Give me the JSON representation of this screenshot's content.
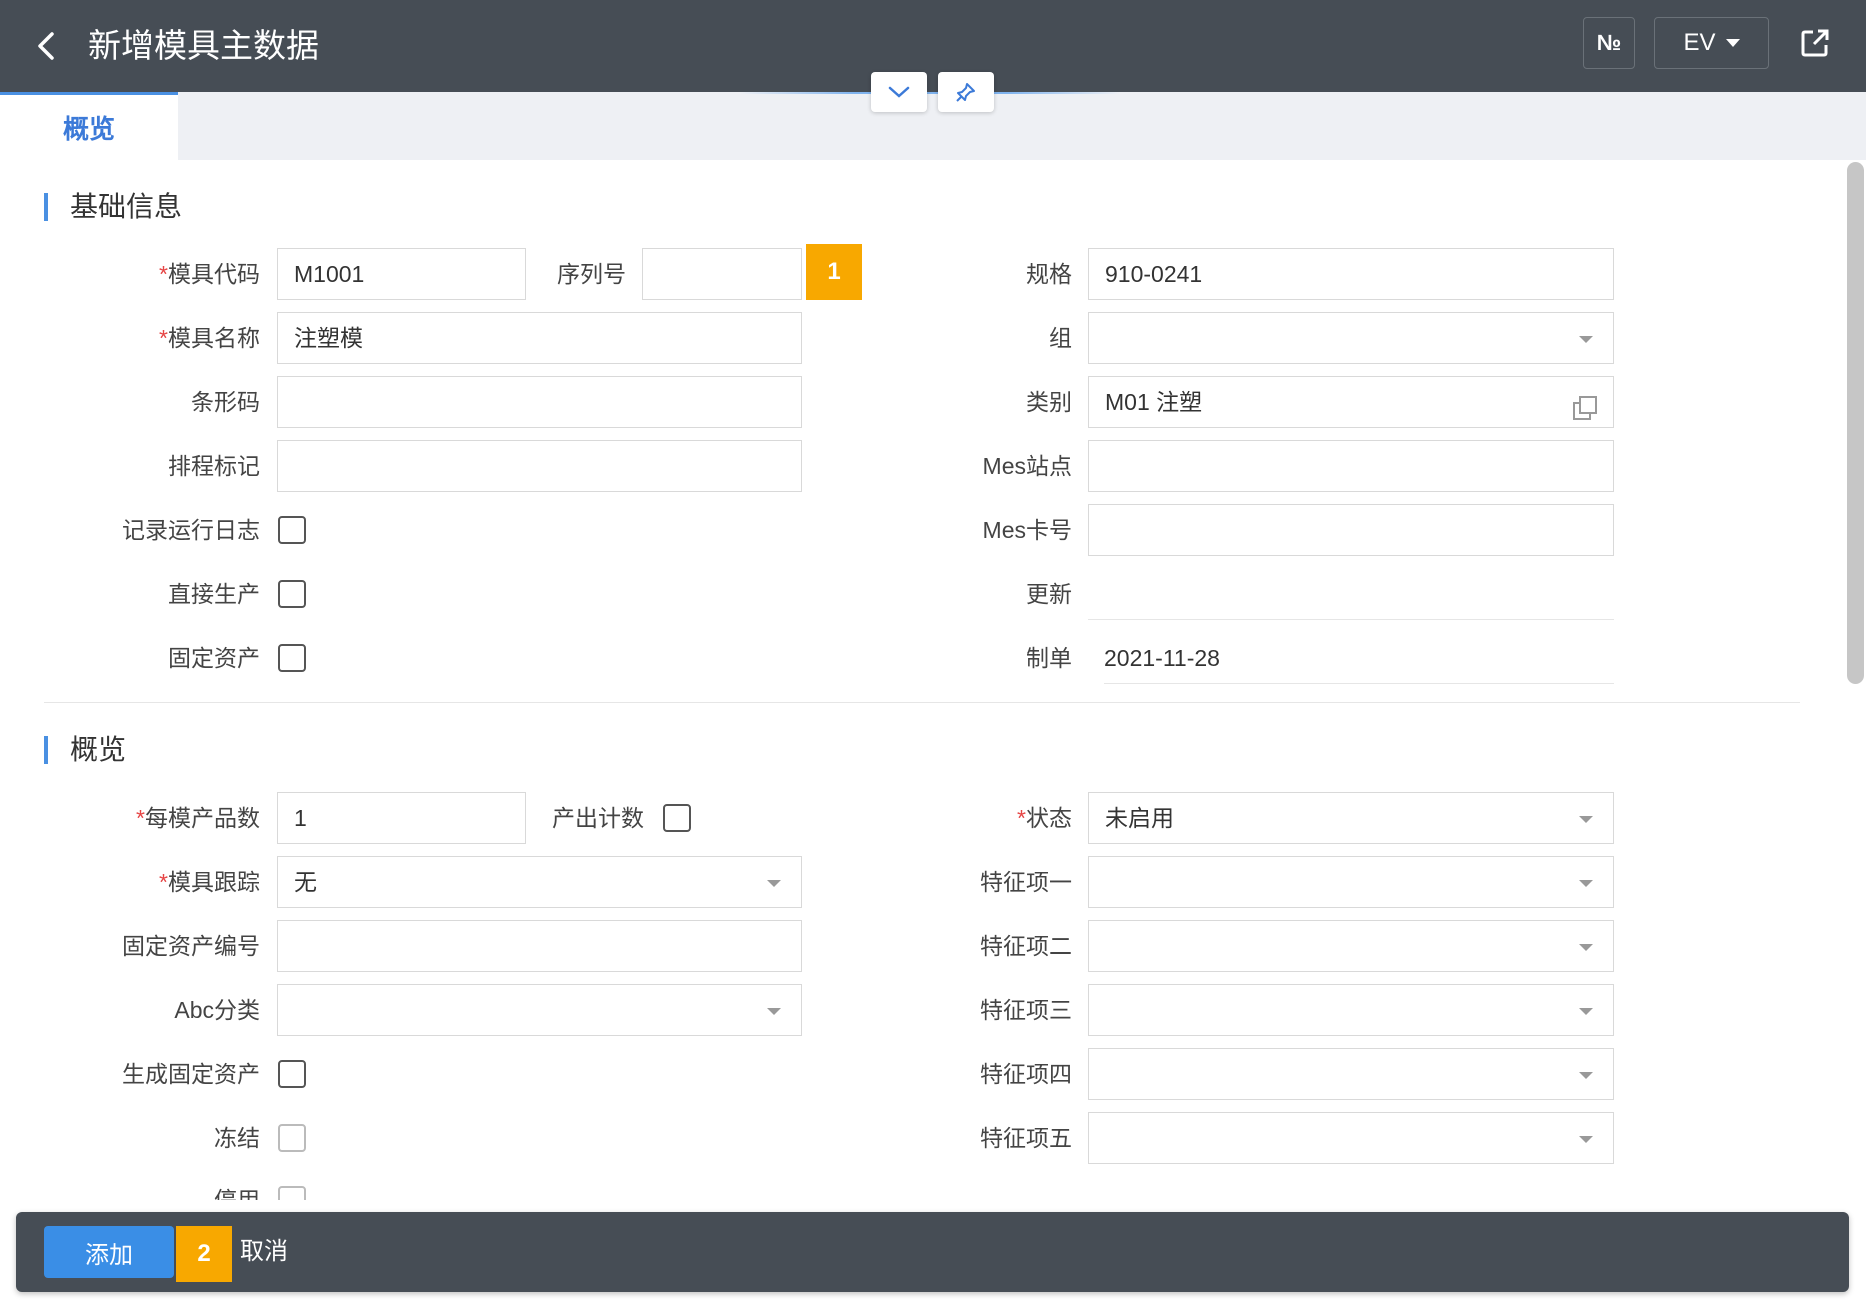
{
  "header": {
    "title": "新增模具主数据",
    "no_button": "№",
    "ev_button": "EV"
  },
  "tabs": [
    {
      "label": "概览"
    }
  ],
  "sections": {
    "basic": "基础信息",
    "overview": "概览"
  },
  "basic": {
    "mold_code": {
      "label": "模具代码",
      "value": "M1001",
      "required": "*"
    },
    "serial_no": {
      "label": "序列号",
      "value": ""
    },
    "spec": {
      "label": "规格",
      "value": "910-0241"
    },
    "mold_name": {
      "label": "模具名称",
      "value": "注塑模",
      "required": "*"
    },
    "group": {
      "label": "组",
      "value": ""
    },
    "barcode": {
      "label": "条形码",
      "value": ""
    },
    "category": {
      "label": "类别",
      "value": "M01 注塑"
    },
    "schedule_mark": {
      "label": "排程标记",
      "value": ""
    },
    "mes_station": {
      "label": "Mes站点",
      "value": ""
    },
    "log_run": {
      "label": "记录运行日志",
      "checked": false
    },
    "mes_card": {
      "label": "Mes卡号",
      "value": ""
    },
    "direct_prod": {
      "label": "直接生产",
      "checked": false
    },
    "update": {
      "label": "更新",
      "value": ""
    },
    "fixed_asset": {
      "label": "固定资产",
      "checked": false
    },
    "creator": {
      "label": "制单",
      "value": "2021-11-28"
    }
  },
  "overview": {
    "per_mold": {
      "label": "每模产品数",
      "value": "1",
      "required": "*"
    },
    "output_count": {
      "label": "产出计数",
      "checked": false
    },
    "status": {
      "label": "状态",
      "value": "未启用",
      "required": "*"
    },
    "tracking": {
      "label": "模具跟踪",
      "value": "无",
      "required": "*"
    },
    "feature1": {
      "label": "特征项一",
      "value": ""
    },
    "asset_no": {
      "label": "固定资产编号",
      "value": ""
    },
    "feature2": {
      "label": "特征项二",
      "value": ""
    },
    "abc": {
      "label": "Abc分类",
      "value": ""
    },
    "feature3": {
      "label": "特征项三",
      "value": ""
    },
    "gen_asset": {
      "label": "生成固定资产",
      "checked": false
    },
    "feature4": {
      "label": "特征项四",
      "value": ""
    },
    "freeze": {
      "label": "冻结",
      "checked": false
    },
    "feature5": {
      "label": "特征项五",
      "value": ""
    },
    "enabled": {
      "label": "停用",
      "checked": false
    }
  },
  "badges": {
    "one": "1",
    "two": "2"
  },
  "footer": {
    "add": "添加",
    "cancel": "取消"
  },
  "colors": {
    "header_bg": "#464d55",
    "accent": "#4a90e2",
    "badge": "#f8a800",
    "primary_button": "#3a8ee6"
  }
}
